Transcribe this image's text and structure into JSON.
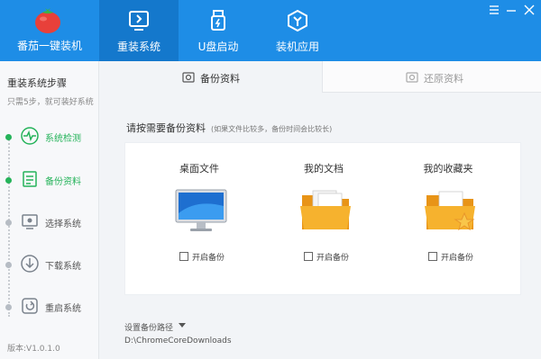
{
  "app": {
    "name": "番茄一键装机",
    "logo_text": "番茄一键装机"
  },
  "nav": {
    "tabs": [
      {
        "label": "重装系统",
        "icon": "reinstall-icon",
        "active": true
      },
      {
        "label": "U盘启动",
        "icon": "usb-icon",
        "active": false
      },
      {
        "label": "装机应用",
        "icon": "apps-icon",
        "active": false
      }
    ]
  },
  "window_controls": {
    "minimize_icon": "minimize-icon",
    "close_icon": "close-icon",
    "menu_icon": "menu-icon"
  },
  "sidebar": {
    "title": "重装系统步骤",
    "subtitle": "只需5步，就可装好系统",
    "steps": [
      {
        "label": "系统检测",
        "icon": "detect-icon",
        "done": true
      },
      {
        "label": "备份资料",
        "icon": "backup-icon",
        "done": true
      },
      {
        "label": "选择系统",
        "icon": "choose-system-icon",
        "done": false
      },
      {
        "label": "下载系统",
        "icon": "download-icon",
        "done": false
      },
      {
        "label": "重启系统",
        "icon": "restart-icon",
        "done": false
      }
    ],
    "version": "版本:V1.0.1.0"
  },
  "tabs": {
    "backup": {
      "label": "备份资料",
      "icon": "backup-tab-icon",
      "active": true
    },
    "restore": {
      "label": "还原资料",
      "icon": "restore-tab-icon",
      "active": false
    }
  },
  "main": {
    "section_title": "请按需要备份资料",
    "section_hint": "(如果文件比较多，备份时间会比较长)",
    "cards": [
      {
        "title": "桌面文件",
        "icon": "desktop-monitor-icon",
        "checkbox_label": "开启备份",
        "checked": false
      },
      {
        "title": "我的文档",
        "icon": "documents-folder-icon",
        "checkbox_label": "开启备份",
        "checked": false
      },
      {
        "title": "我的收藏夹",
        "icon": "favorites-folder-icon",
        "checkbox_label": "开启备份",
        "checked": false
      }
    ],
    "path_label": "设置备份路径",
    "path_value": "D:\\ChromeCoreDownloads"
  },
  "colors": {
    "header": "#1e8de6",
    "header_active": "#1478cc",
    "success": "#25b35a",
    "folder": "#f6a623"
  }
}
